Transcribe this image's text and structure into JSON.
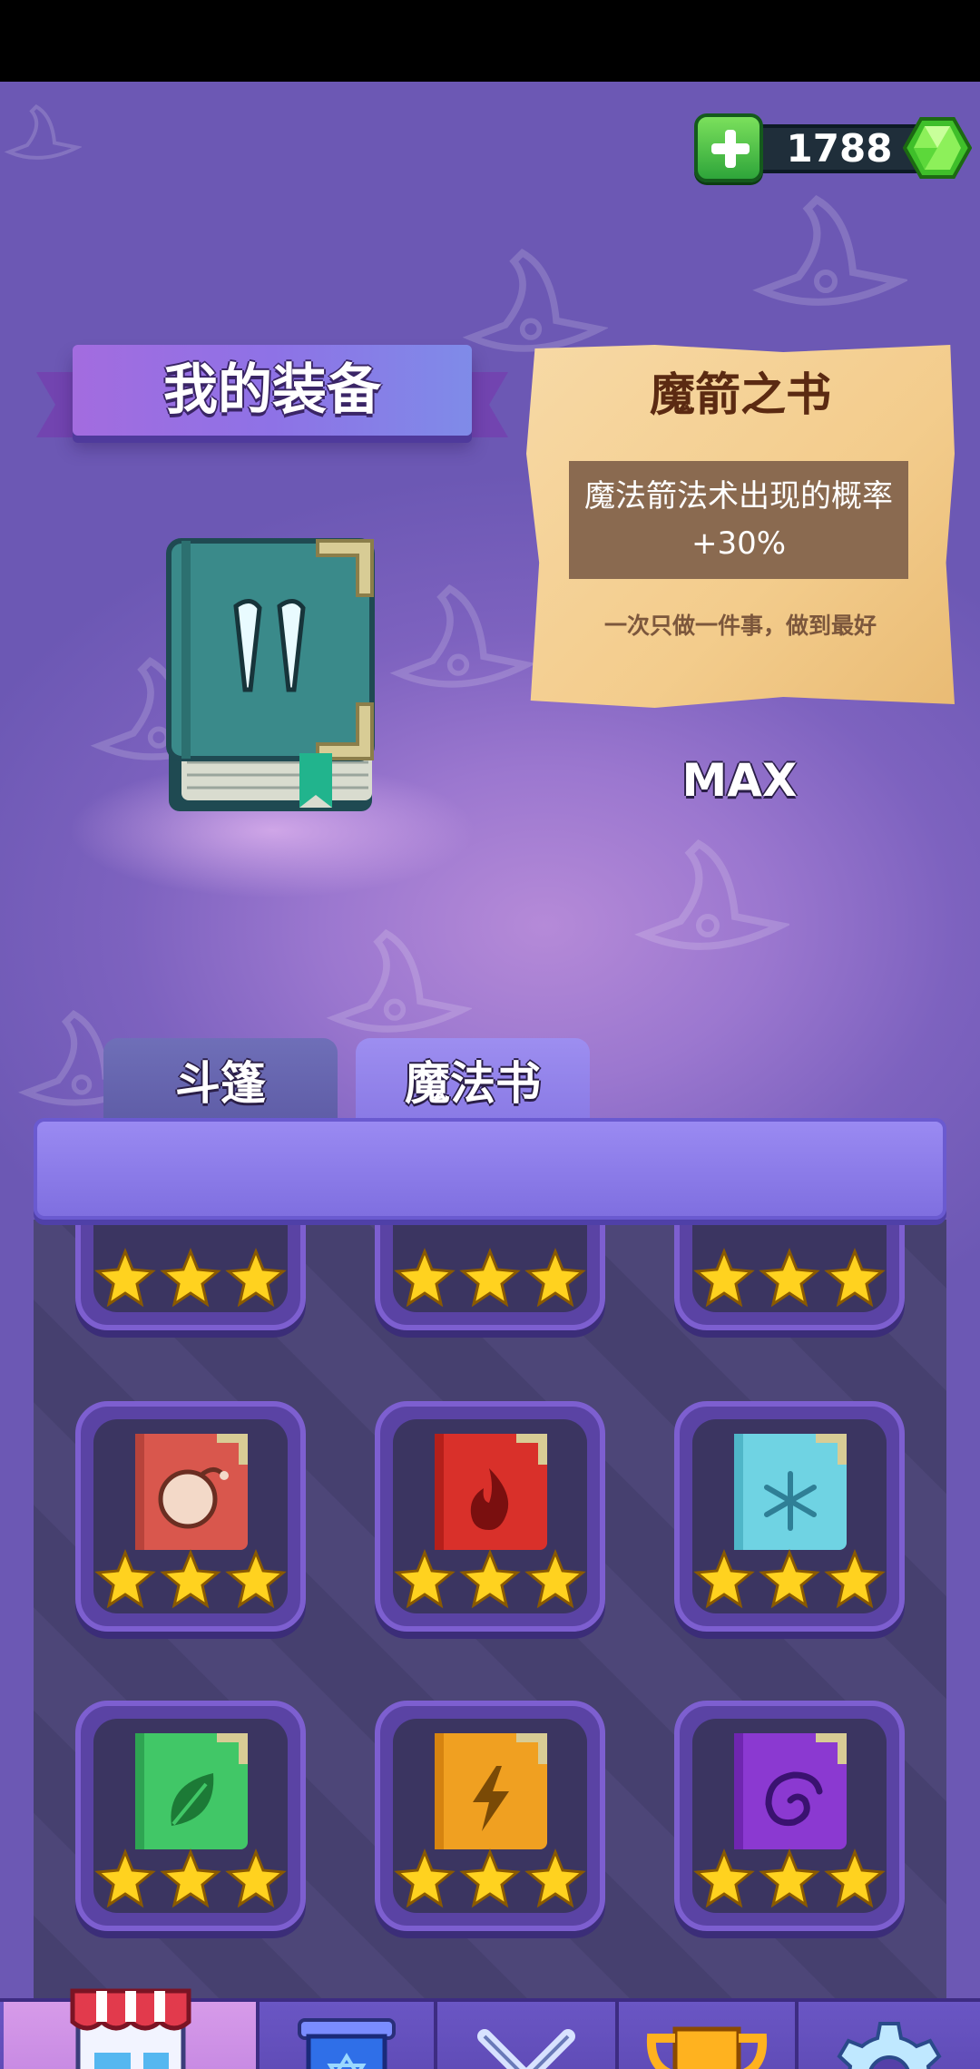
{
  "currency": {
    "amount": "1788",
    "plus_icon": "plus-icon",
    "gem_icon": "green-gem-icon"
  },
  "title": "我的装备",
  "item": {
    "name": "魔箭之书",
    "description": "魔法箭法术出现的概率+30%",
    "quote": "一次只做一件事，做到最好",
    "level_label": "MAX"
  },
  "tabs": [
    {
      "label": "斗篷",
      "selected": false
    },
    {
      "label": "魔法书",
      "selected": true
    }
  ],
  "grid": {
    "rows": [
      [
        {
          "icon": "partial-book-icon",
          "stars": 3
        },
        {
          "icon": "partial-book-icon",
          "stars": 3
        },
        {
          "icon": "partial-book-icon",
          "stars": 3
        }
      ],
      [
        {
          "icon": "bomb-book-icon",
          "color": "#d9574d",
          "stars": 3
        },
        {
          "icon": "fire-book-icon",
          "color": "#d9302a",
          "stars": 3
        },
        {
          "icon": "snowflake-book-icon",
          "color": "#6fd3e3",
          "stars": 3
        }
      ],
      [
        {
          "icon": "leaf-book-icon",
          "color": "#41c767",
          "stars": 3
        },
        {
          "icon": "lightning-book-icon",
          "color": "#f0a021",
          "stars": 3
        },
        {
          "icon": "swirl-book-icon",
          "color": "#8b39d1",
          "stars": 3
        }
      ]
    ]
  },
  "nav": [
    {
      "icon": "shop-icon",
      "selected": true
    },
    {
      "icon": "shield-banner-icon",
      "selected": false
    },
    {
      "icon": "crossed-swords-icon",
      "selected": false
    },
    {
      "icon": "trophy-icon",
      "selected": false
    },
    {
      "icon": "gear-icon",
      "selected": false
    }
  ]
}
